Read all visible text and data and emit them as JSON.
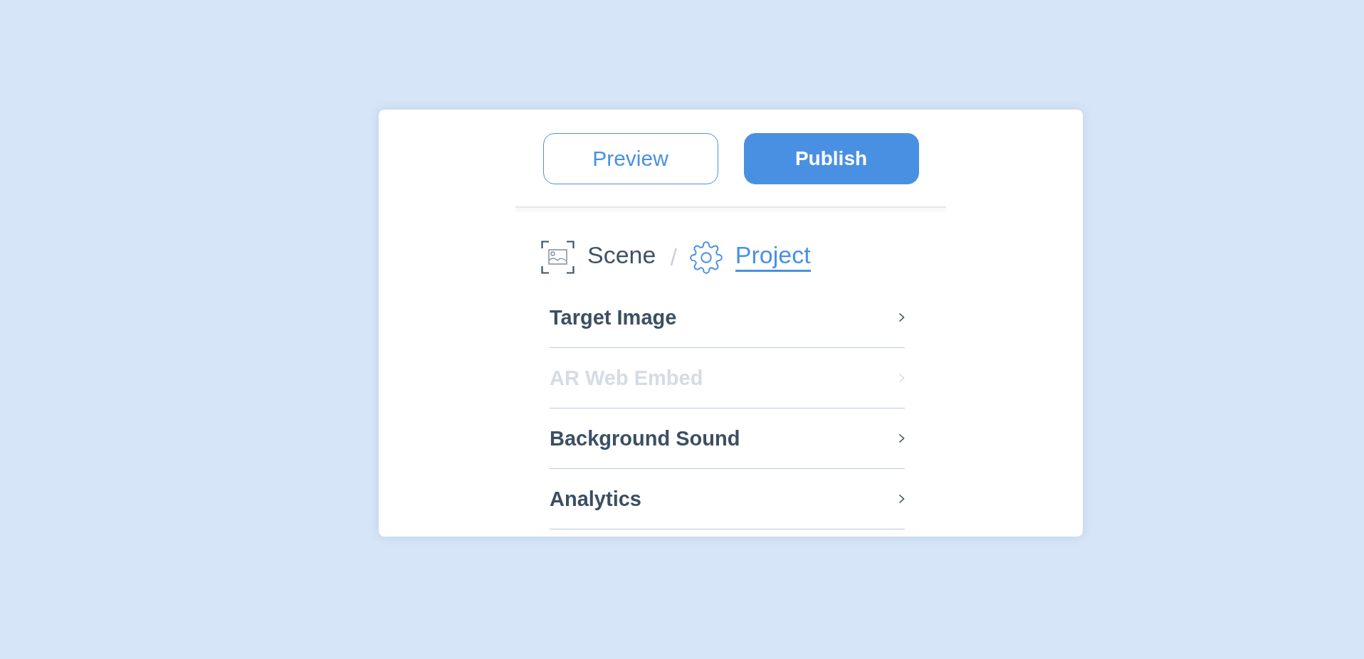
{
  "actions": [
    {
      "label": "Preview",
      "kind": "secondary"
    },
    {
      "label": "Publish",
      "kind": "primary"
    }
  ],
  "breadcrumb": {
    "items": [
      {
        "label": "Scene",
        "kind": "scene",
        "selected": false
      },
      {
        "label": "Project",
        "kind": "settings",
        "selected": true
      }
    ],
    "separator": "/"
  },
  "menu": {
    "items": [
      {
        "label": "Target Image",
        "disabled": false
      },
      {
        "label": "AR Web Embed",
        "disabled": true
      },
      {
        "label": "Background Sound",
        "disabled": false
      },
      {
        "label": "Analytics",
        "disabled": false
      }
    ]
  }
}
